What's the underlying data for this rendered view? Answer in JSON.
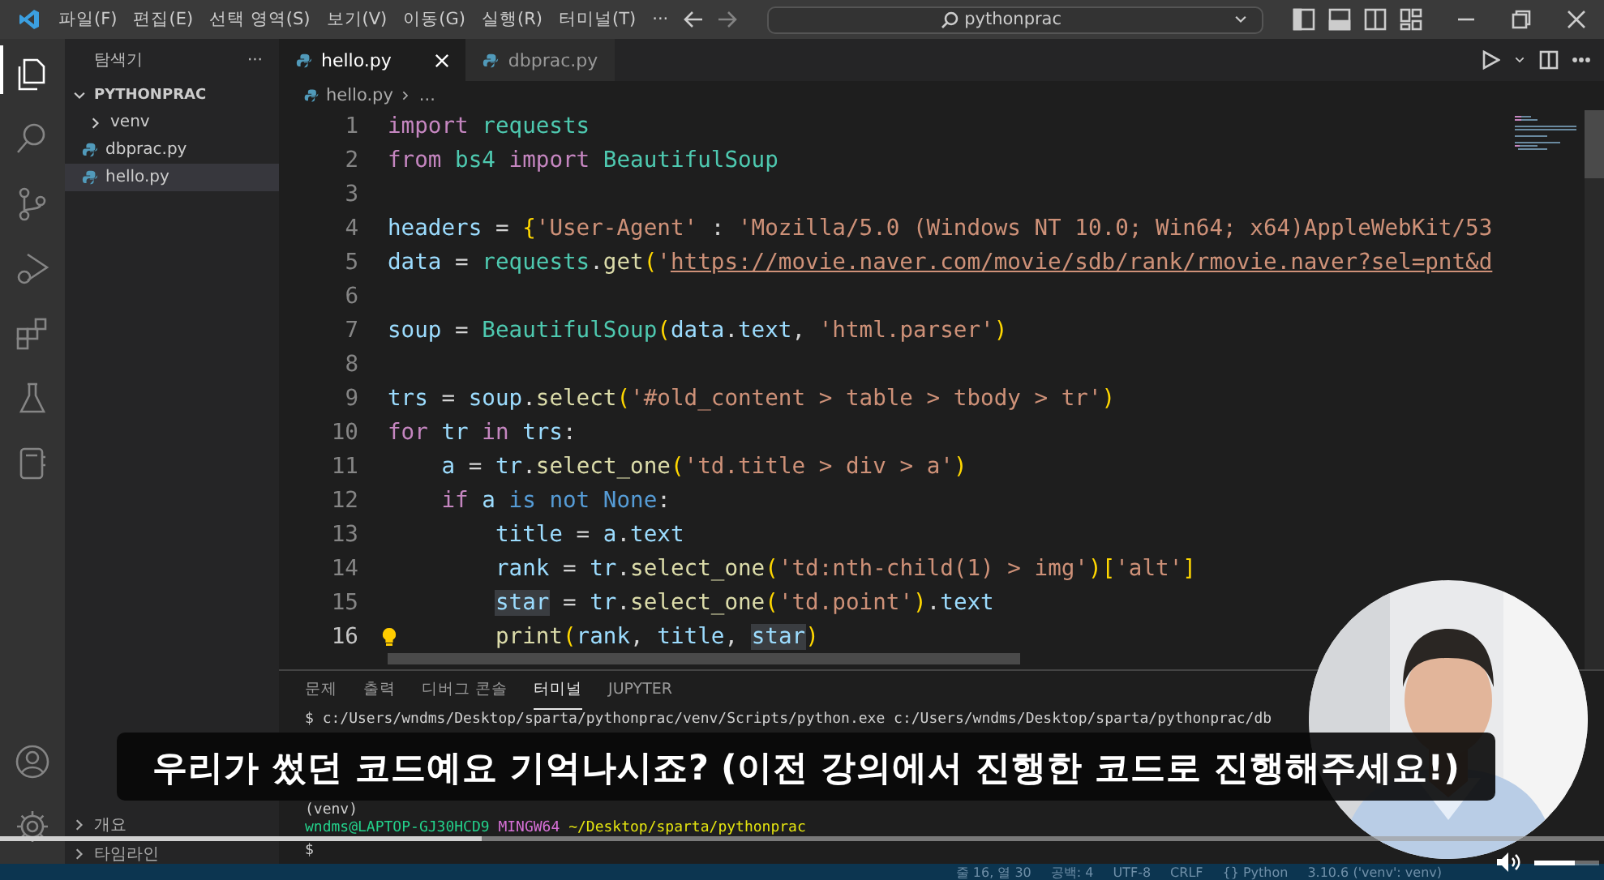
{
  "window": {
    "menu": [
      "파일(F)",
      "편집(E)",
      "선택 영역(S)",
      "보기(V)",
      "이동(G)",
      "실행(R)",
      "터미널(T)"
    ],
    "more": "···",
    "search": "pythonprac"
  },
  "sidebar": {
    "title": "탐색기",
    "more": "···",
    "folder": {
      "name": "PYTHONPRAC",
      "expanded": true
    },
    "items": [
      {
        "name": "venv",
        "kind": "folder",
        "expanded": false,
        "selected": false
      },
      {
        "name": "dbprac.py",
        "kind": "python",
        "selected": false
      },
      {
        "name": "hello.py",
        "kind": "python",
        "selected": true
      }
    ],
    "sections": [
      {
        "name": "개요",
        "expanded": false
      },
      {
        "name": "타임라인",
        "expanded": false
      }
    ]
  },
  "tabs": [
    {
      "label": "hello.py",
      "selected": true
    },
    {
      "label": "dbprac.py",
      "selected": false
    }
  ],
  "breadcrumb": {
    "file": "hello.py",
    "rest": "..."
  },
  "editor": {
    "lines": [
      {
        "number": "1",
        "current": false,
        "lightbulb": false,
        "tokens": [
          {
            "text": "import",
            "kind": "keyword"
          },
          {
            "text": " requests",
            "kind": "module"
          }
        ]
      },
      {
        "number": "2",
        "current": false,
        "lightbulb": false,
        "tokens": [
          {
            "text": "from",
            "kind": "keyword"
          },
          {
            "text": " bs4",
            "kind": "module"
          },
          {
            "text": " import",
            "kind": "keyword"
          },
          {
            "text": " BeautifulSoup",
            "kind": "module"
          }
        ]
      },
      {
        "number": "3",
        "current": false,
        "lightbulb": false
      },
      {
        "number": "4",
        "current": false,
        "lightbulb": false,
        "tokens": [
          {
            "text": "headers",
            "kind": "variable"
          },
          {
            "text": " = "
          },
          {
            "text": "{",
            "kind": "bracket"
          },
          {
            "text": "'User-Agent'",
            "kind": "string"
          },
          {
            "text": " : "
          },
          {
            "text": "'Mozilla/5.0 (Windows NT 10.0; Win64; x64)AppleWebKit/53",
            "kind": "string"
          }
        ]
      },
      {
        "number": "5",
        "current": false,
        "lightbulb": false,
        "tokens": [
          {
            "text": "data",
            "kind": "variable"
          },
          {
            "text": " = "
          },
          {
            "text": "requests",
            "kind": "module"
          },
          {
            "text": "."
          },
          {
            "text": "get",
            "kind": "function"
          },
          {
            "text": "(",
            "kind": "bracket"
          },
          {
            "text": "'",
            "kind": "string"
          },
          {
            "text": "https://movie.naver.com/movie/sdb/rank/rmovie.naver?sel=pnt&d",
            "kind": "url"
          }
        ]
      },
      {
        "number": "6",
        "current": false,
        "lightbulb": false
      },
      {
        "number": "7",
        "current": false,
        "lightbulb": false,
        "tokens": [
          {
            "text": "soup",
            "kind": "variable"
          },
          {
            "text": " = "
          },
          {
            "text": "BeautifulSoup",
            "kind": "module"
          },
          {
            "text": "(",
            "kind": "bracket"
          },
          {
            "text": "data",
            "kind": "variable"
          },
          {
            "text": "."
          },
          {
            "text": "text",
            "kind": "variable"
          },
          {
            "text": ", "
          },
          {
            "text": "'html.parser'",
            "kind": "string"
          },
          {
            "text": ")",
            "kind": "bracket"
          }
        ]
      },
      {
        "number": "8",
        "current": false,
        "lightbulb": false
      },
      {
        "number": "9",
        "current": false,
        "lightbulb": false,
        "tokens": [
          {
            "text": "trs",
            "kind": "variable"
          },
          {
            "text": " = "
          },
          {
            "text": "soup",
            "kind": "variable"
          },
          {
            "text": "."
          },
          {
            "text": "select",
            "kind": "function"
          },
          {
            "text": "(",
            "kind": "bracket"
          },
          {
            "text": "'#old_content > table > tbody > tr'",
            "kind": "string"
          },
          {
            "text": ")",
            "kind": "bracket"
          }
        ]
      },
      {
        "number": "10",
        "current": false,
        "lightbulb": false,
        "tokens": [
          {
            "text": "for",
            "kind": "keyword"
          },
          {
            "text": " tr",
            "kind": "variable"
          },
          {
            "text": " in",
            "kind": "keyword"
          },
          {
            "text": " trs",
            "kind": "variable"
          },
          {
            "text": ":"
          }
        ]
      },
      {
        "number": "11",
        "current": false,
        "lightbulb": false,
        "tokens": [
          {
            "text": "    a",
            "kind": "variable"
          },
          {
            "text": " = "
          },
          {
            "text": "tr",
            "kind": "variable"
          },
          {
            "text": "."
          },
          {
            "text": "select_one",
            "kind": "function"
          },
          {
            "text": "(",
            "kind": "bracket"
          },
          {
            "text": "'td.title > div > a'",
            "kind": "string"
          },
          {
            "text": ")",
            "kind": "bracket"
          }
        ]
      },
      {
        "number": "12",
        "current": false,
        "lightbulb": false,
        "tokens": [
          {
            "text": "    if",
            "kind": "keyword"
          },
          {
            "text": " a",
            "kind": "variable"
          },
          {
            "text": " is not",
            "kind": "constant"
          },
          {
            "text": " None",
            "kind": "constant"
          },
          {
            "text": ":"
          }
        ]
      },
      {
        "number": "13",
        "current": false,
        "lightbulb": false,
        "tokens": [
          {
            "text": "        title",
            "kind": "variable"
          },
          {
            "text": " = "
          },
          {
            "text": "a",
            "kind": "variable"
          },
          {
            "text": "."
          },
          {
            "text": "text",
            "kind": "variable"
          }
        ]
      },
      {
        "number": "14",
        "current": false,
        "lightbulb": false,
        "tokens": [
          {
            "text": "        rank",
            "kind": "variable"
          },
          {
            "text": " = "
          },
          {
            "text": "tr",
            "kind": "variable"
          },
          {
            "text": "."
          },
          {
            "text": "select_one",
            "kind": "function"
          },
          {
            "text": "(",
            "kind": "bracket"
          },
          {
            "text": "'td:nth-child(1) > img'",
            "kind": "string"
          },
          {
            "text": ")",
            "kind": "bracket"
          },
          {
            "text": "[",
            "kind": "bracket"
          },
          {
            "text": "'alt'",
            "kind": "string"
          },
          {
            "text": "]",
            "kind": "bracket"
          }
        ]
      },
      {
        "number": "15",
        "current": false,
        "lightbulb": false,
        "tokens": [
          {
            "text": "        star",
            "kind": "variable",
            "highlight": true
          },
          {
            "text": " = "
          },
          {
            "text": "tr",
            "kind": "variable"
          },
          {
            "text": "."
          },
          {
            "text": "select_one",
            "kind": "function"
          },
          {
            "text": "(",
            "kind": "bracket"
          },
          {
            "text": "'td.point'",
            "kind": "string"
          },
          {
            "text": ")",
            "kind": "bracket"
          },
          {
            "text": "."
          },
          {
            "text": "text",
            "kind": "variable"
          }
        ]
      },
      {
        "number": "16",
        "current": true,
        "lightbulb": true,
        "tokens": [
          {
            "text": "        print",
            "kind": "function"
          },
          {
            "text": "(",
            "kind": "bracket"
          },
          {
            "text": "rank",
            "kind": "variable"
          },
          {
            "text": ", "
          },
          {
            "text": "title",
            "kind": "variable"
          },
          {
            "text": ", "
          },
          {
            "text": "star",
            "kind": "variable",
            "highlight": true
          },
          {
            "text": ")",
            "kind": "bracket"
          }
        ]
      }
    ]
  },
  "panel": {
    "tabs": [
      {
        "label": "문제",
        "selected": false
      },
      {
        "label": "출력",
        "selected": false
      },
      {
        "label": "디버그 콘솔",
        "selected": false
      },
      {
        "label": "터미널",
        "selected": true
      },
      {
        "label": "JUPYTER",
        "selected": false
      }
    ],
    "terminal": [
      {
        "kind": "command",
        "text": "$ c:/Users/wndms/Desktop/sparta/pythonprac/venv/Scripts/python.exe c:/Users/wndms/Desktop/sparta/pythonprac/db"
      },
      {
        "kind": "hidden"
      },
      {
        "kind": "output",
        "text": "(venv)"
      },
      {
        "kind": "prompt",
        "user": "wndms@LAPTOP-GJ30HCD9",
        "shell": "MINGW64",
        "path": "~/Desktop/sparta/pythonprac"
      },
      {
        "kind": "input",
        "text": "$"
      }
    ]
  },
  "status_bar": {
    "items": [
      "줄 16, 열 30",
      "공백: 4",
      "UTF-8",
      "CRLF",
      "{} Python",
      "3.10.6 ('venv': venv)"
    ]
  },
  "video": {
    "subtitle": "우리가 썼던 코드예요 기억나시죠? (이전 강의에서 진행한 코드로 진행해주세요!)",
    "progress": {
      "level": 0.3
    },
    "volume": {
      "level": 0.62
    }
  }
}
